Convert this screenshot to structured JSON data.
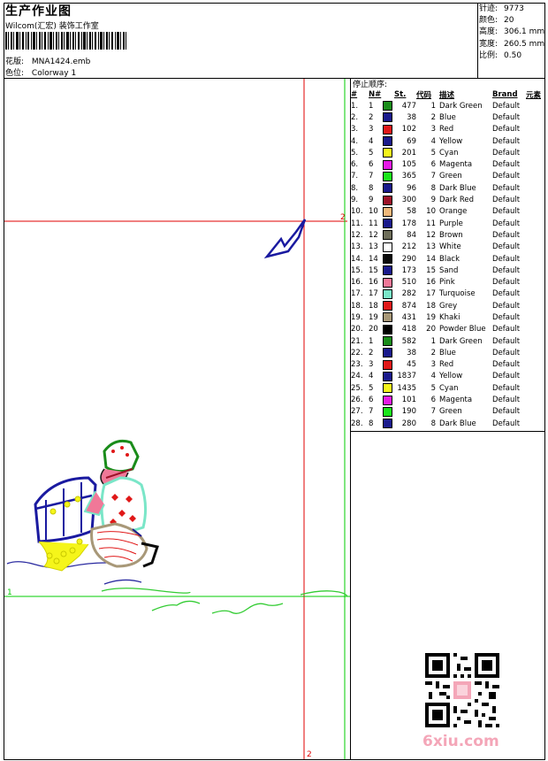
{
  "header": {
    "title": "生产作业图",
    "subtitle": "Wilcom(汇宏) 装饰工作室",
    "design_label": "花版:",
    "design_value": "MNA1424.emb",
    "colorway_label": "色位:",
    "colorway_value": "Colorway 1"
  },
  "stats": [
    {
      "label": "针迹:",
      "value": "9773"
    },
    {
      "label": "颜色:",
      "value": "20"
    },
    {
      "label": "高度:",
      "value": "306.1 mm"
    },
    {
      "label": "宽度:",
      "value": "260.5 mm"
    },
    {
      "label": "比例:",
      "value": "0.50"
    }
  ],
  "color_table": {
    "title": "停止顺序:",
    "headers": {
      "num": "#",
      "n": "N#",
      "st": "St.",
      "code": "代码",
      "desc": "描述",
      "brand": "Brand",
      "elem": "元素"
    },
    "rows": [
      {
        "i": "1.",
        "n": "1",
        "color": "#1a8c1a",
        "st": "477",
        "code": "1",
        "name": "Dark Green",
        "brand": "Default"
      },
      {
        "i": "2.",
        "n": "2",
        "color": "#1a1a8c",
        "st": "38",
        "code": "2",
        "name": "Blue",
        "brand": "Default"
      },
      {
        "i": "3.",
        "n": "3",
        "color": "#e01818",
        "st": "102",
        "code": "3",
        "name": "Red",
        "brand": "Default"
      },
      {
        "i": "4.",
        "n": "4",
        "color": "#1a1a8c",
        "st": "69",
        "code": "4",
        "name": "Yellow",
        "brand": "Default"
      },
      {
        "i": "5.",
        "n": "5",
        "color": "#f5f51a",
        "st": "201",
        "code": "5",
        "name": "Cyan",
        "brand": "Default"
      },
      {
        "i": "6.",
        "n": "6",
        "color": "#e61ae6",
        "st": "105",
        "code": "6",
        "name": "Magenta",
        "brand": "Default"
      },
      {
        "i": "7.",
        "n": "7",
        "color": "#1ae61a",
        "st": "365",
        "code": "7",
        "name": "Green",
        "brand": "Default"
      },
      {
        "i": "8.",
        "n": "8",
        "color": "#1a1a8c",
        "st": "96",
        "code": "8",
        "name": "Dark Blue",
        "brand": "Default"
      },
      {
        "i": "9.",
        "n": "9",
        "color": "#9c1228",
        "st": "300",
        "code": "9",
        "name": "Dark Red",
        "brand": "Default"
      },
      {
        "i": "10.",
        "n": "10",
        "color": "#f0b87a",
        "st": "58",
        "code": "10",
        "name": "Orange",
        "brand": "Default"
      },
      {
        "i": "11.",
        "n": "11",
        "color": "#1a1a8c",
        "st": "178",
        "code": "11",
        "name": "Purple",
        "brand": "Default"
      },
      {
        "i": "12.",
        "n": "12",
        "color": "#6e6e5a",
        "st": "84",
        "code": "12",
        "name": "Brown",
        "brand": "Default"
      },
      {
        "i": "13.",
        "n": "13",
        "color": "#ffffff",
        "st": "212",
        "code": "13",
        "name": "White",
        "brand": "Default"
      },
      {
        "i": "14.",
        "n": "14",
        "color": "#0a0a0a",
        "st": "290",
        "code": "14",
        "name": "Black",
        "brand": "Default"
      },
      {
        "i": "15.",
        "n": "15",
        "color": "#1a1a8c",
        "st": "173",
        "code": "15",
        "name": "Sand",
        "brand": "Default"
      },
      {
        "i": "16.",
        "n": "16",
        "color": "#f07898",
        "st": "510",
        "code": "16",
        "name": "Pink",
        "brand": "Default"
      },
      {
        "i": "17.",
        "n": "17",
        "color": "#7ae6c8",
        "st": "282",
        "code": "17",
        "name": "Turquoise",
        "brand": "Default"
      },
      {
        "i": "18.",
        "n": "18",
        "color": "#e01818",
        "st": "874",
        "code": "18",
        "name": "Grey",
        "brand": "Default"
      },
      {
        "i": "19.",
        "n": "19",
        "color": "#a89878",
        "st": "431",
        "code": "19",
        "name": "Khaki",
        "brand": "Default"
      },
      {
        "i": "20.",
        "n": "20",
        "color": "#000000",
        "st": "418",
        "code": "20",
        "name": "Powder Blue",
        "brand": "Default"
      },
      {
        "i": "21.",
        "n": "1",
        "color": "#1a8c1a",
        "st": "582",
        "code": "1",
        "name": "Dark Green",
        "brand": "Default"
      },
      {
        "i": "22.",
        "n": "2",
        "color": "#1a1a8c",
        "st": "38",
        "code": "2",
        "name": "Blue",
        "brand": "Default"
      },
      {
        "i": "23.",
        "n": "3",
        "color": "#e01818",
        "st": "45",
        "code": "3",
        "name": "Red",
        "brand": "Default"
      },
      {
        "i": "24.",
        "n": "4",
        "color": "#1a1a8c",
        "st": "1837",
        "code": "4",
        "name": "Yellow",
        "brand": "Default"
      },
      {
        "i": "25.",
        "n": "5",
        "color": "#f5f51a",
        "st": "1435",
        "code": "5",
        "name": "Cyan",
        "brand": "Default"
      },
      {
        "i": "26.",
        "n": "6",
        "color": "#e61ae6",
        "st": "101",
        "code": "6",
        "name": "Magenta",
        "brand": "Default"
      },
      {
        "i": "27.",
        "n": "7",
        "color": "#1ae61a",
        "st": "190",
        "code": "7",
        "name": "Green",
        "brand": "Default"
      },
      {
        "i": "28.",
        "n": "8",
        "color": "#1a1a8c",
        "st": "280",
        "code": "8",
        "name": "Dark Blue",
        "brand": "Default"
      }
    ]
  },
  "guides": {
    "red_h_label": "2",
    "red_v_label": "2",
    "green_h_label": "1"
  },
  "watermark": {
    "text": "6xiu.com"
  }
}
